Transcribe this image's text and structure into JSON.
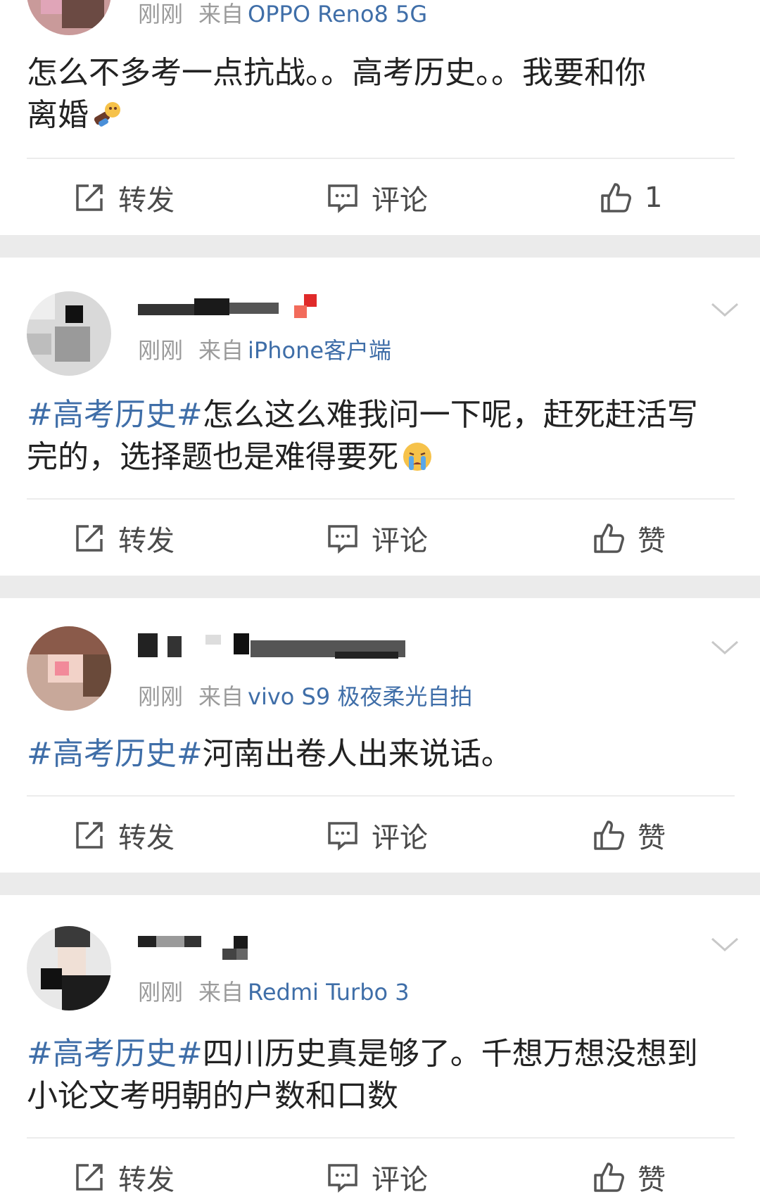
{
  "posts": [
    {
      "time": "刚刚",
      "from": "来自",
      "device": "OPPO Reno8 5G",
      "text_lines": [
        "怎么不多考一点抗战。。高考历史。。我要和你",
        "离婚"
      ],
      "emoji": "angry-fist-emoji",
      "actions": {
        "repost": "转发",
        "comment": "评论",
        "like": "1"
      }
    },
    {
      "time": "刚刚",
      "from": "来自",
      "device": "iPhone客户端",
      "tag": "#高考历史#",
      "text_lines": [
        "怎么这么难我问一下呢，赶死赶活写",
        "完的，选择题也是难得要死"
      ],
      "emoji": "crying-face-emoji",
      "actions": {
        "repost": "转发",
        "comment": "评论",
        "like": "赞"
      }
    },
    {
      "time": "刚刚",
      "from": "来自",
      "device": "vivo S9 极夜柔光自拍",
      "tag": "#高考历史#",
      "text_lines": [
        "河南出卷人出来说话。"
      ],
      "actions": {
        "repost": "转发",
        "comment": "评论",
        "like": "赞"
      }
    },
    {
      "time": "刚刚",
      "from": "来自",
      "device": "Redmi Turbo 3",
      "tag": "#高考历史#",
      "text_lines": [
        "四川历史真是够了。千想万想没想到",
        "小论文考明朝的户数和口数"
      ],
      "actions": {
        "repost": "转发",
        "comment": "评论",
        "like": "赞"
      }
    }
  ],
  "icons": {
    "repost": "repost-icon",
    "comment": "comment-icon",
    "like": "thumbs-up-icon",
    "menu": "chevron-down-icon"
  },
  "colors": {
    "link": "#3f6ea8",
    "meta": "#9b9b9b",
    "separator": "#ebebeb"
  }
}
